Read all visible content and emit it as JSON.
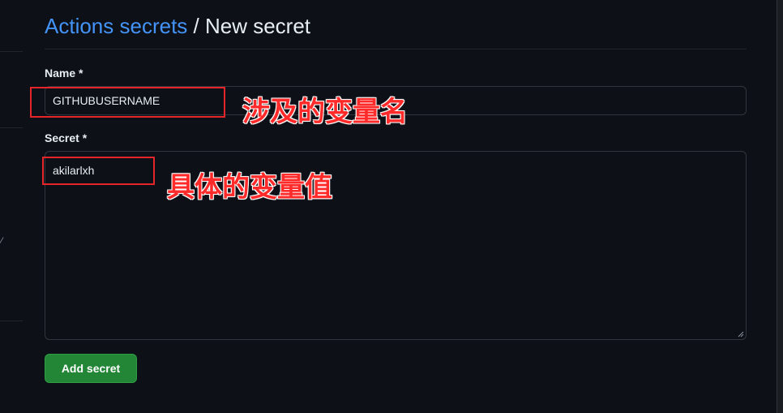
{
  "breadcrumb": {
    "parent": "Actions secrets",
    "separator": " / ",
    "current": "New secret"
  },
  "form": {
    "name_label": "Name *",
    "name_value": "GITHUBUSERNAME",
    "secret_label": "Secret *",
    "secret_value": "akilarlxh",
    "submit_label": "Add secret"
  },
  "annotations": {
    "name_note": "涉及的变量名",
    "secret_note": "具体的变量值"
  },
  "colors": {
    "background": "#0d1117",
    "link": "#4493f8",
    "button": "#238636",
    "annotation": "#e5252a"
  }
}
